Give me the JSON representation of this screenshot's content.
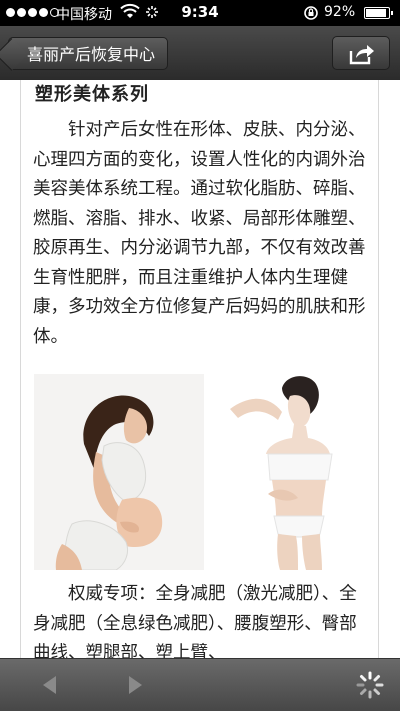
{
  "status_bar": {
    "carrier": "中国移动",
    "time": "9:34",
    "battery_percent": "92%",
    "signal_bars_filled": 4,
    "signal_bars_total": 5
  },
  "nav": {
    "back_label": "喜丽产后恢复中心",
    "share_icon": "share-icon"
  },
  "article": {
    "heading": "塑形美体系列",
    "paragraph1": "针对产后女性在形体、皮肤、内分泌、心理四方面的变化，设置人性化的内调外治美容美体系统工程。通过软化脂肪、碎脂、燃脂、溶脂、排水、收紧、局部形体雕塑、胶原再生、内分泌调节九部，不仅有效改善生育性肥胖，而且注重维护人体内生理健康，多功效全方位修复产后妈妈的肌肤和形体。",
    "paragraph2": "权威专项：全身减肥（激光减肥）、全身减肥（全息绿色减肥）、腰腹塑形、臀部曲线、塑腿部、塑上臂、"
  },
  "toolbar": {
    "back_icon": "triangle-left-icon",
    "forward_icon": "triangle-right-icon",
    "loading_icon": "spinner-icon"
  }
}
